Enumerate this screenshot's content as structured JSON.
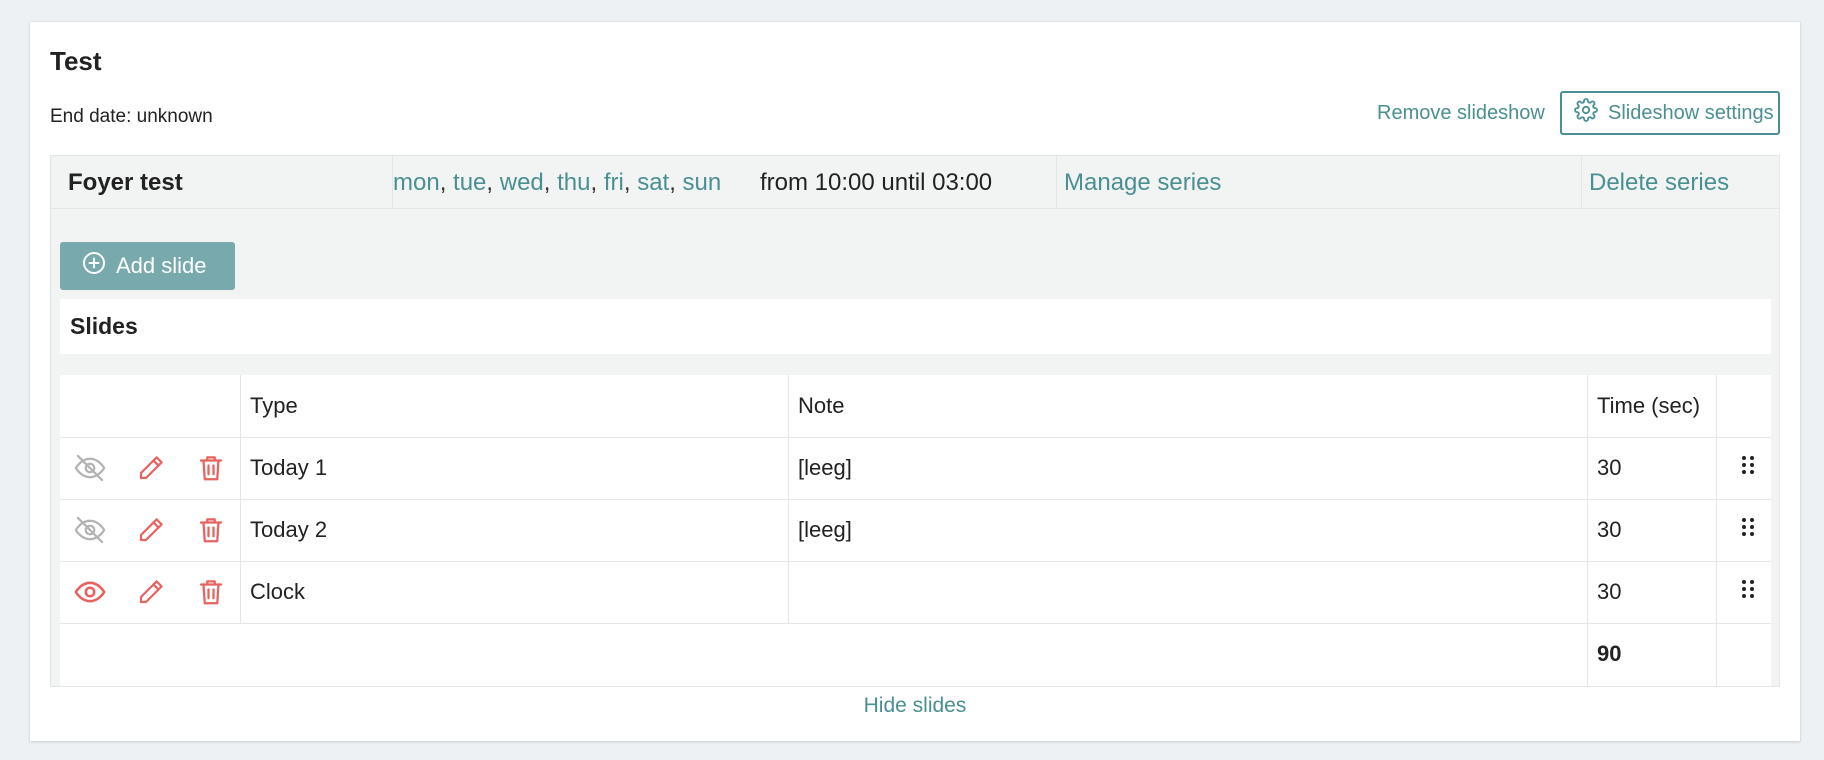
{
  "slideshow": {
    "title": "Test",
    "end_date": "End date: unknown",
    "remove_label": "Remove slideshow",
    "settings_label": "Slideshow settings"
  },
  "series": {
    "name": "Foyer test",
    "days": [
      "mon",
      "tue",
      "wed",
      "thu",
      "fri",
      "sat",
      "sun"
    ],
    "time_range": "from 10:00 until 03:00",
    "manage_label": "Manage series",
    "delete_label": "Delete series",
    "add_slide_label": "Add slide",
    "slides_heading": "Slides"
  },
  "table": {
    "headers": {
      "type": "Type",
      "note": "Note",
      "time": "Time (sec)"
    },
    "rows": [
      {
        "type": "Today 1",
        "note": "[leeg]",
        "time": "30",
        "visible": false
      },
      {
        "type": "Today 2",
        "note": "[leeg]",
        "time": "30",
        "visible": false
      },
      {
        "type": "Clock",
        "note": "",
        "time": "30",
        "visible": true
      }
    ],
    "total": "90"
  },
  "footer": {
    "hide_label": "Hide slides"
  },
  "colors": {
    "accent": "#4a8f92",
    "danger": "#e8625f",
    "muted": "#b3b3b3",
    "button_bg": "#78a9ac"
  },
  "icons": [
    "gear-icon",
    "plus-circle-icon",
    "eye-slash-icon",
    "eye-icon",
    "pencil-icon",
    "trash-icon",
    "drag-handle-icon"
  ]
}
